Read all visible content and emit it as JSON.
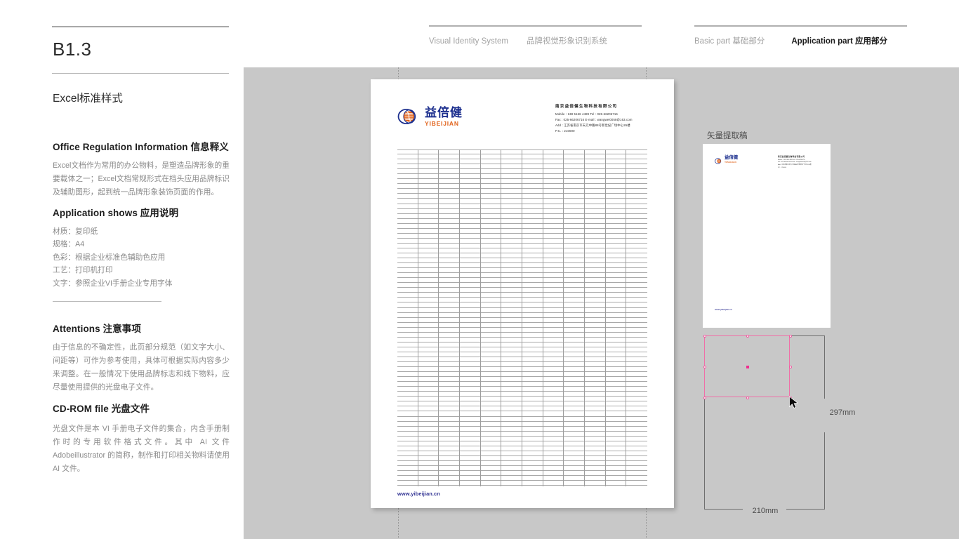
{
  "header": {
    "nav_left": [
      {
        "label": "Visual Identity System",
        "lang": "en",
        "active": false
      },
      {
        "label": "品牌视觉形象识别系统",
        "lang": "cn",
        "active": false
      }
    ],
    "nav_right": [
      {
        "label": "Basic part  基础部分",
        "active": false
      },
      {
        "label": "Application part  应用部分",
        "active": true
      }
    ]
  },
  "sidebar": {
    "section_code": "B1.3",
    "section_title": "Excel标准样式",
    "blocks": [
      {
        "heading": "Office Regulation Information 信息释义",
        "paragraph": "Excel文档作为常用的办公物料，是塑造品牌形象的重要载体之一；Excel文档常规形式在档头应用品牌标识及辅助图形，起到统一品牌形象装饰页面的作用。"
      },
      {
        "heading": "Application shows 应用说明",
        "specs": [
          "材质：复印纸",
          "规格：A4",
          "色彩：根据企业标准色辅助色应用",
          "工艺：打印机打印",
          "文字：参照企业VI手册企业专用字体"
        ]
      },
      {
        "heading": "Attentions 注意事项",
        "paragraph": "由于信息的不确定性，此页部分规范（如文字大小、间距等）可作为参考使用，具体可根据实际内容多少来调整。在一般情况下使用品牌标志和线下物料，应尽量使用提供的光盘电子文件。"
      },
      {
        "heading": "CD-ROM file 光盘文件",
        "paragraph": "光盘文件是本 VI 手册电子文件的集合，内含手册制作时的专用软件格式文件。其中 AI 文件 Adobeillustrator 的简称，制作和打印相关物料请使用 AI 文件。"
      }
    ]
  },
  "sheet": {
    "logo": {
      "cn": "益倍健",
      "en": "YIBEIJIAN",
      "icon": "globe-dna-logo-icon"
    },
    "contact": {
      "company": "南京益倍健生物科技有限公司",
      "lines": [
        "Mobile : 138 5166 4489    Tel : 025-66206716",
        "Fax : 025-66206716    E-mail : wangwei0058@163.com",
        "Add : 江苏省南京市天元中路88号新世纪广场中心26楼",
        "P.C. : 210000"
      ]
    },
    "url": "www.yibeijian.cn",
    "grid": {
      "columns": 12,
      "rows": 68
    }
  },
  "right_panel": {
    "vector_label": "矢量提取稿",
    "thumbnail": {
      "logo_cn": "益倍健",
      "logo_en": "YIBEIJIAN",
      "company": "南京益倍健生物科技有限公司",
      "lines": [
        "Mobile : 138 5166 4489   Tel : 025-66206716",
        "Fax : 025-66206716   E-mail : wangwei0058@163.com",
        "Add : 江苏省南京市天元中路88号新世纪广场中心26楼",
        "P.C. : 210000"
      ],
      "url": "www.yibeijian.cn"
    },
    "dimensions": {
      "width_label": "210mm",
      "height_label": "297mm",
      "selection_color": "#ef5aa0",
      "cursor": "arrow-cursor-icon"
    }
  },
  "colors": {
    "canvas_bg": "#c8c8c8",
    "brand_blue": "#1c2f8e",
    "brand_orange": "#e1621a",
    "url_blue": "#2f3192",
    "accent_pink": "#ef5aa0"
  }
}
